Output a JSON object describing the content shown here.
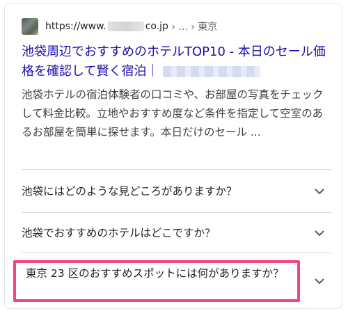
{
  "result": {
    "url_prefix": "https://www.",
    "url_suffix": "co.jp",
    "breadcrumb": "› ... › 東京",
    "title_text": "池袋周辺でおすすめのホテルTOP10 - 本日のセール価格を確認して賢く宿泊｜",
    "snippet": "池袋ホテルの宿泊体験者の口コミや、お部屋の写真をチェックして料金比較。立地やおすすめ度など条件を指定して空室のあるお部屋を簡単に探せます。本日だけのセール ..."
  },
  "faq": [
    {
      "question": "池袋にはどのような見どころがありますか？"
    },
    {
      "question": "池袋でおすすめのホテルはどこですか？"
    },
    {
      "question": "東京 23 区のおすすめスポットには何がありますか？"
    }
  ],
  "colors": {
    "link": "#1a0dab",
    "highlight": "#f0487c",
    "divider": "#dadce0"
  },
  "icons": {
    "expand": "chevron-down-icon",
    "site": "favicon-icon"
  }
}
